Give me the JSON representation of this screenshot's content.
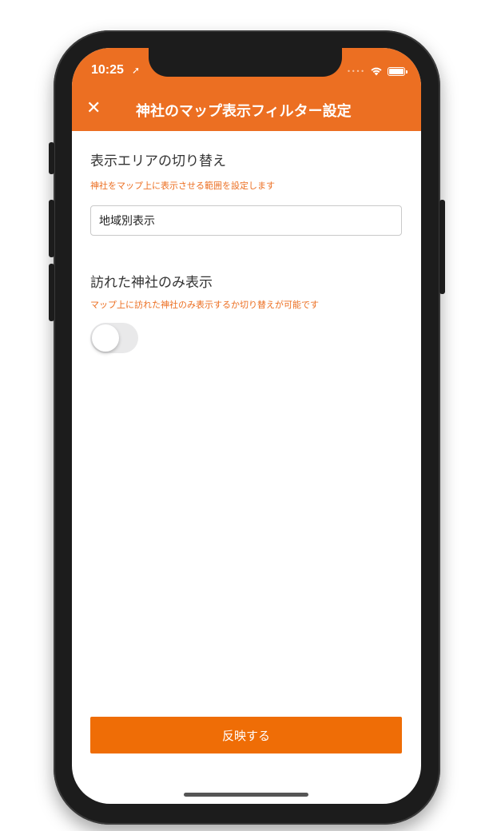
{
  "status_bar": {
    "time": "10:25"
  },
  "header": {
    "close_label": "✕",
    "title": "神社のマップ表示フィルター設定",
    "accent_color": "#ec6f22"
  },
  "display_area": {
    "title": "表示エリアの切り替え",
    "description": "神社をマップ上に表示させる範囲を設定します",
    "selected_value": "地域別表示"
  },
  "visited_only": {
    "title": "訪れた神社のみ表示",
    "description": "マップ上に訪れた神社のみ表示するか切り替えが可能です",
    "toggle_on": false
  },
  "footer": {
    "apply_label": "反映する",
    "button_color": "#ef6d06"
  }
}
